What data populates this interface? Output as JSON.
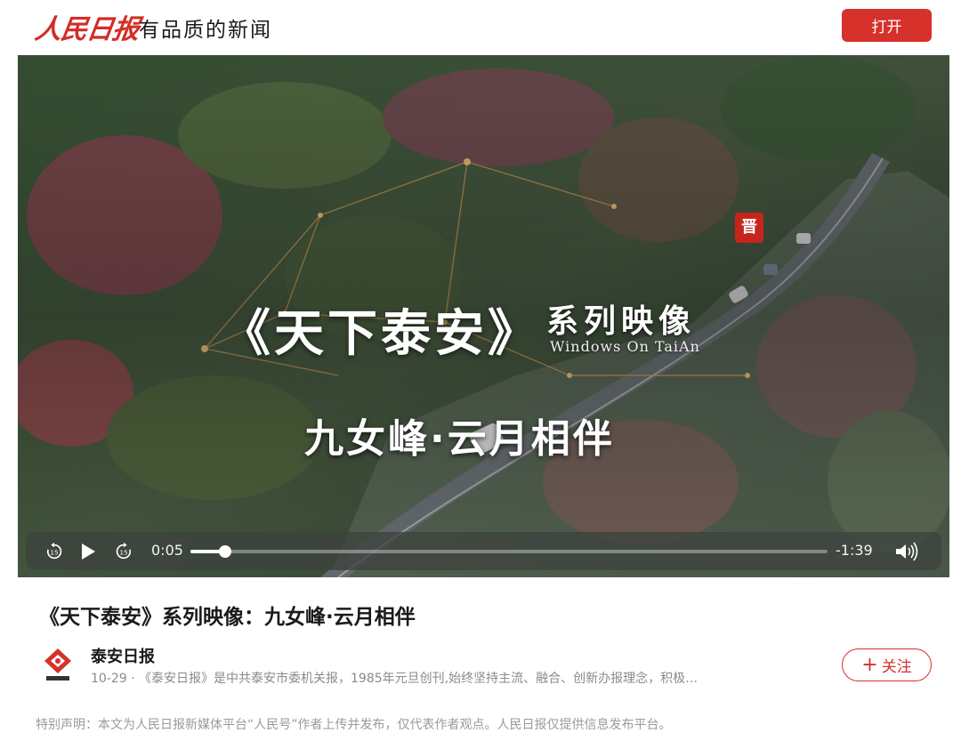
{
  "header": {
    "logo_text": "人民日报",
    "slogan": "有品质的新闻",
    "open_label": "打开"
  },
  "video": {
    "overlay_title": "《天下泰安》",
    "overlay_series": "系列映像",
    "overlay_english": "Windows On TaiAn",
    "overlay_subtitle": "九女峰·云月相伴",
    "seal_text": "晋",
    "current_time": "0:05",
    "remaining_time": "-1:39",
    "progress_fraction": 0.055,
    "icons": [
      "rewind-15-icon",
      "play-icon",
      "forward-15-icon",
      "volume-icon"
    ]
  },
  "article": {
    "title": "《天下泰安》系列映像：九女峰·云月相伴",
    "author_name": "泰安日报",
    "author_desc": "10-29 · 《泰安日报》是中共泰安市委机关报，1985年元旦创刊,始终坚持主流、融合、创新办报理念，积极…",
    "follow_label": "关注",
    "disclaimer": "特别声明：本文为人民日报新媒体平台“人民号”作者上传并发布，仅代表作者观点。人民日报仅提供信息发布平台。"
  },
  "colors": {
    "brand_red": "#d6312a",
    "text_dark": "#1a1a1a",
    "text_gray": "#8a8a8a"
  }
}
